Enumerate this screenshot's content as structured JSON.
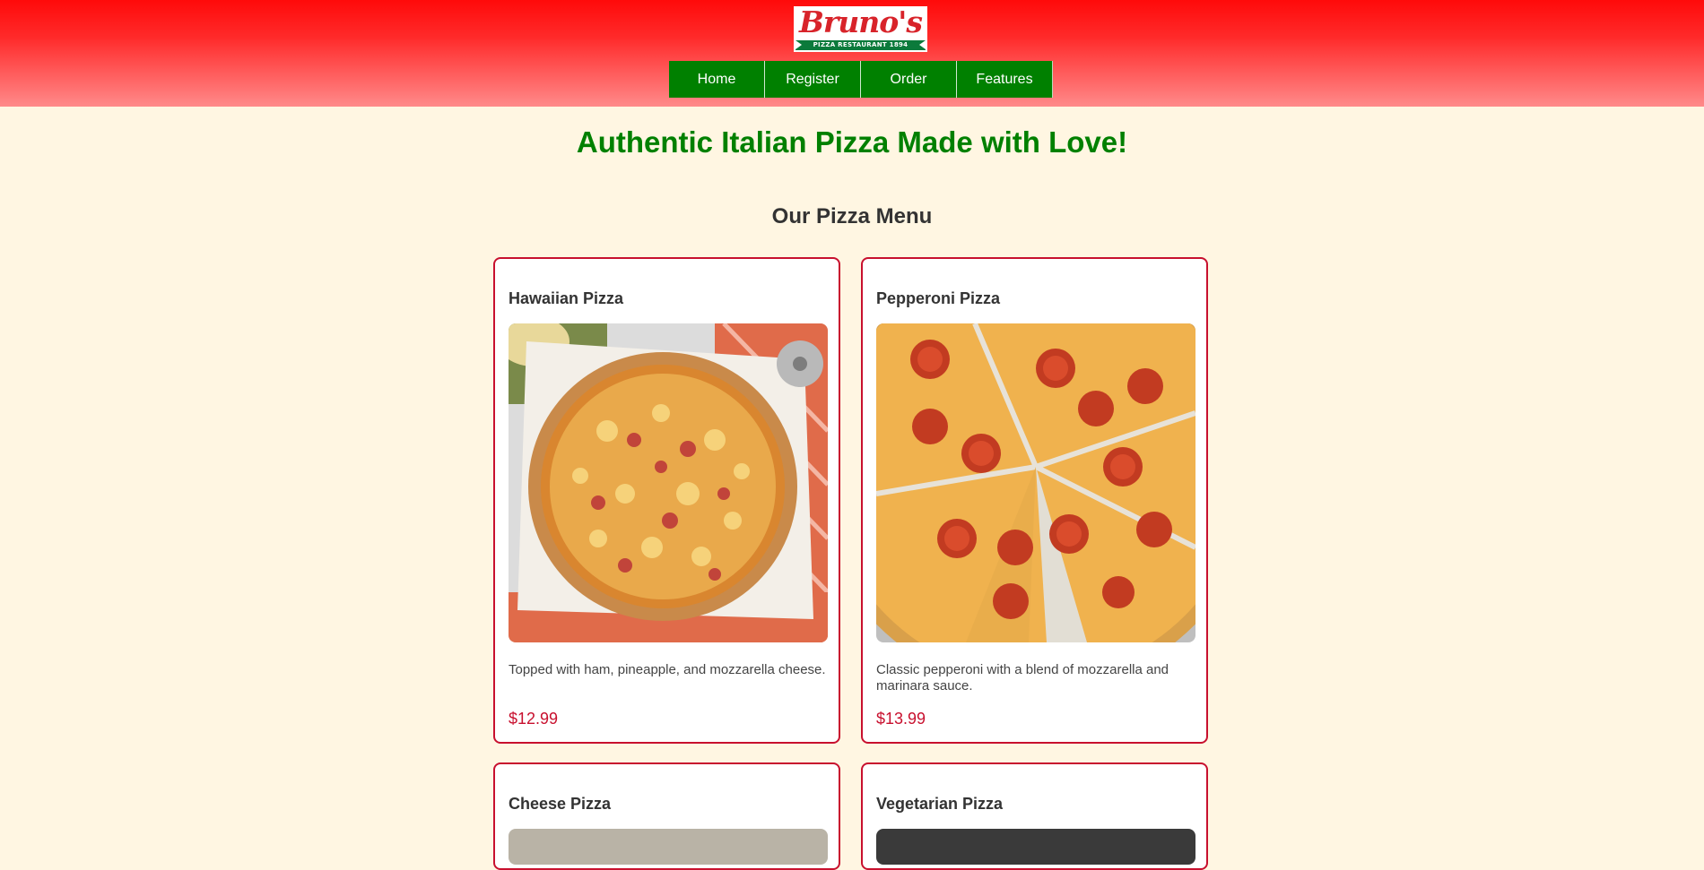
{
  "header": {
    "logo_name": "Bruno's",
    "logo_subtitle": "PIZZA RESTAURANT 1894",
    "nav": [
      "Home",
      "Register",
      "Order",
      "Features"
    ]
  },
  "tagline": "Authentic Italian Pizza Made with Love!",
  "menu": {
    "title": "Our Pizza Menu",
    "items": [
      {
        "name": "Hawaiian Pizza",
        "description": "Topped with ham, pineapple, and mozzarella cheese.",
        "price": "$12.99"
      },
      {
        "name": "Pepperoni Pizza",
        "description": "Classic pepperoni with a blend of mozzarella and marinara sauce.",
        "price": "$13.99"
      },
      {
        "name": "Cheese Pizza"
      },
      {
        "name": "Vegetarian Pizza"
      }
    ]
  },
  "colors": {
    "accent_green": "#008000",
    "accent_red": "#c8102e",
    "header_red": "#ff0a0a",
    "page_bg": "#fff6e2"
  }
}
